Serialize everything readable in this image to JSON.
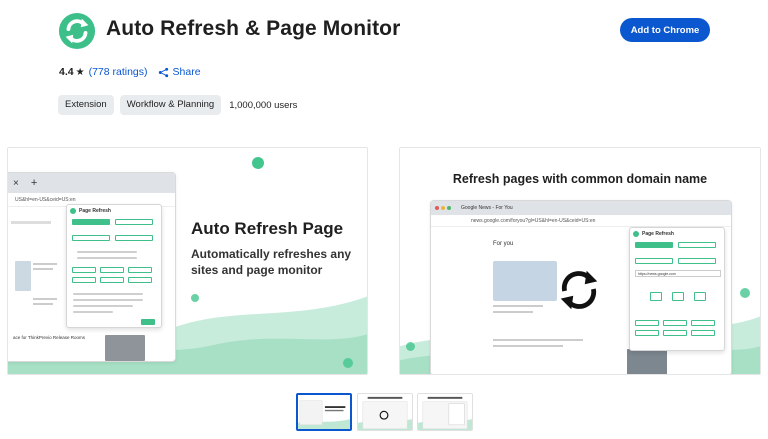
{
  "header": {
    "title": "Auto Refresh & Page Monitor",
    "add_button": "Add to Chrome"
  },
  "rating": {
    "value": "4.4",
    "count": "(778 ratings)",
    "share": "Share"
  },
  "chips": [
    "Extension",
    "Workflow & Planning"
  ],
  "users": "1,000,000 users",
  "screenshots": [
    {
      "headline": "Auto Refresh Page",
      "subline": "Automatically refreshes any sites and page monitor",
      "tab_plus": "+",
      "tab_close": "×",
      "address": "US&hl=en-US&ceid=US:en",
      "popup_title": "Page Refresh",
      "caption": "ace for ThinkPrevio Release Rooms"
    },
    {
      "headline": "Refresh pages with common domain name",
      "tab_title": "Google News - For You",
      "address": "news.google.com/foryou?gl=US&hl=en-US&ceid=US:en",
      "section": "For you",
      "popup_title": "Page Refresh",
      "popup_url": "https://news.google.com"
    }
  ],
  "colors": {
    "accent": "#0b57d0",
    "brand_green": "#3fbf8a"
  },
  "icons": {
    "logo": "refresh-cycle-icon",
    "star": "star-icon",
    "share": "share-icon"
  }
}
